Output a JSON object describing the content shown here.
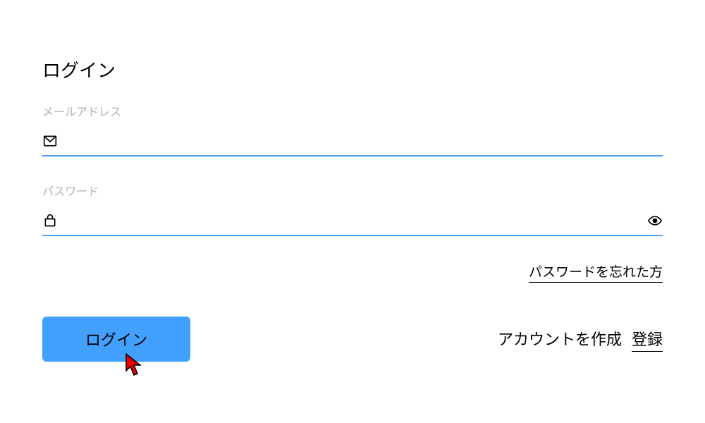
{
  "title": "ログイン",
  "email": {
    "label": "メールアドレス",
    "value": ""
  },
  "password": {
    "label": "パスワード",
    "value": ""
  },
  "forgot_label": "パスワードを忘れた方",
  "login_button": "ログイン",
  "create_account_text": "アカウントを作成",
  "register_link": "登録",
  "colors": {
    "underline": "#4a9eff",
    "button_bg": "#42a0ff"
  }
}
